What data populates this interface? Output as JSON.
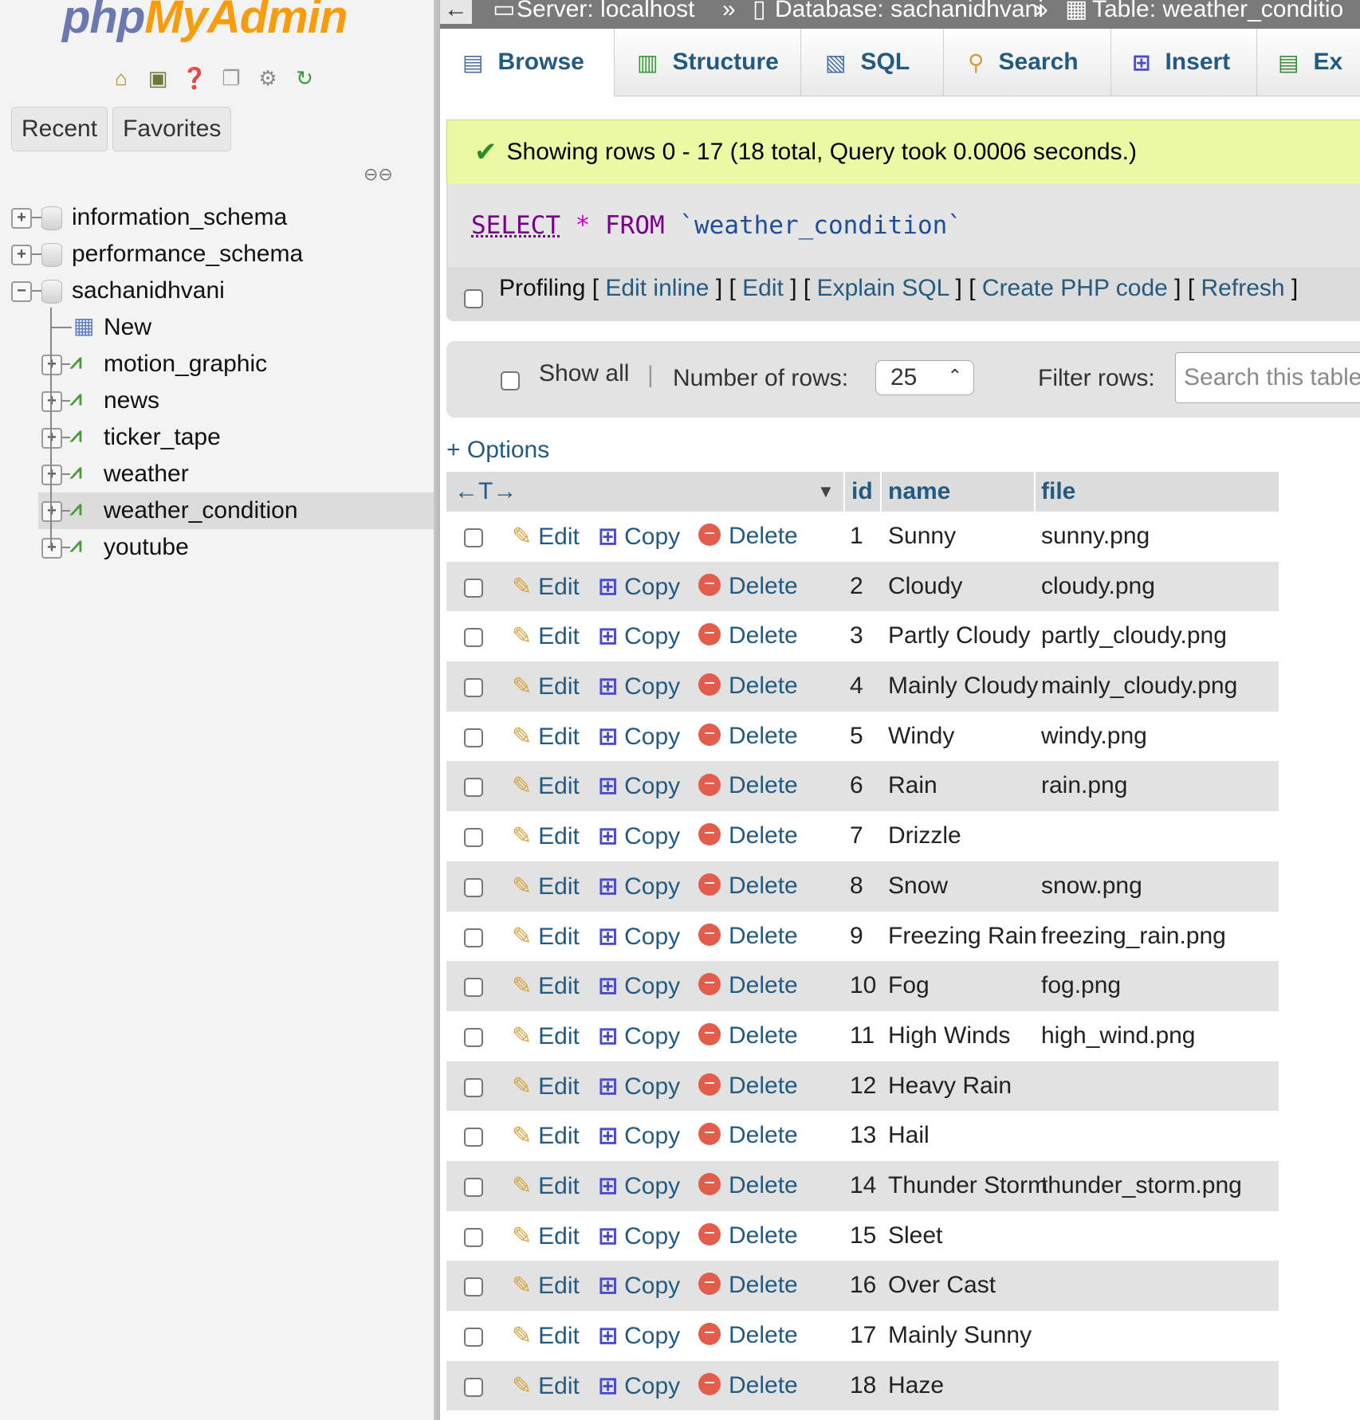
{
  "nav": {
    "logo_php": "php",
    "logo_myadmin": "MyAdmin",
    "icons": [
      "home-icon",
      "exit-icon",
      "help-icon",
      "docs-icon",
      "settings-icon",
      "reload-icon"
    ],
    "tabs": [
      "Recent",
      "Favorites"
    ],
    "tree": [
      {
        "label": "information_schema",
        "type": "database",
        "expanded": false
      },
      {
        "label": "performance_schema",
        "type": "database",
        "expanded": false
      },
      {
        "label": "sachanidhvani",
        "type": "database",
        "expanded": true
      },
      {
        "label": "New",
        "type": "new"
      },
      {
        "label": "motion_graphic",
        "type": "table"
      },
      {
        "label": "news",
        "type": "table"
      },
      {
        "label": "ticker_tape",
        "type": "table"
      },
      {
        "label": "weather",
        "type": "table"
      },
      {
        "label": "weather_condition",
        "type": "table",
        "selected": true
      },
      {
        "label": "youtube",
        "type": "table"
      }
    ]
  },
  "breadcrumb": {
    "back": "←",
    "server": "Server: localhost",
    "sep": "»",
    "database": "Database: sachanidhvani",
    "table": "Table: weather_conditio"
  },
  "tabs": [
    {
      "label": "Browse",
      "icon": "browse-icon",
      "active": true
    },
    {
      "label": "Structure",
      "icon": "structure-icon"
    },
    {
      "label": "SQL",
      "icon": "sql-icon"
    },
    {
      "label": "Search",
      "icon": "search-icon"
    },
    {
      "label": "Insert",
      "icon": "insert-icon"
    },
    {
      "label": "Ex",
      "icon": "export-icon"
    }
  ],
  "success": {
    "message": "Showing rows 0 - 17 (18 total, Query took 0.0006 seconds.)"
  },
  "sql": {
    "select": "SELECT",
    "star": "*",
    "from": "FROM",
    "table": "`weather_condition`"
  },
  "profiling": {
    "label": "Profiling",
    "links": [
      "Edit inline",
      "Edit",
      "Explain SQL",
      "Create PHP code",
      "Refresh"
    ]
  },
  "toolbar": {
    "show_all": "Show all",
    "separator": "|",
    "num_rows_label": "Number of rows:",
    "num_rows_value": "25",
    "filter_label": "Filter rows:",
    "filter_placeholder": "Search this table"
  },
  "options_link": "+ Options",
  "table": {
    "nav_arrows": "←T→",
    "columns": [
      "id",
      "name",
      "file"
    ],
    "actions": {
      "edit": "Edit",
      "copy": "Copy",
      "delete": "Delete"
    },
    "rows": [
      {
        "id": "1",
        "name": "Sunny",
        "file": "sunny.png"
      },
      {
        "id": "2",
        "name": "Cloudy",
        "file": "cloudy.png"
      },
      {
        "id": "3",
        "name": "Partly Cloudy",
        "file": "partly_cloudy.png"
      },
      {
        "id": "4",
        "name": "Mainly Cloudy",
        "file": "mainly_cloudy.png"
      },
      {
        "id": "5",
        "name": "Windy",
        "file": "windy.png"
      },
      {
        "id": "6",
        "name": "Rain",
        "file": "rain.png"
      },
      {
        "id": "7",
        "name": "Drizzle",
        "file": ""
      },
      {
        "id": "8",
        "name": "Snow",
        "file": "snow.png"
      },
      {
        "id": "9",
        "name": "Freezing Rain",
        "file": "freezing_rain.png"
      },
      {
        "id": "10",
        "name": "Fog",
        "file": "fog.png"
      },
      {
        "id": "11",
        "name": "High Winds",
        "file": "high_wind.png"
      },
      {
        "id": "12",
        "name": "Heavy Rain",
        "file": ""
      },
      {
        "id": "13",
        "name": "Hail",
        "file": ""
      },
      {
        "id": "14",
        "name": "Thunder Storm",
        "file": "thunder_storm.png"
      },
      {
        "id": "15",
        "name": "Sleet",
        "file": ""
      },
      {
        "id": "16",
        "name": "Over Cast",
        "file": ""
      },
      {
        "id": "17",
        "name": "Mainly Sunny",
        "file": ""
      },
      {
        "id": "18",
        "name": "Haze",
        "file": ""
      }
    ]
  }
}
